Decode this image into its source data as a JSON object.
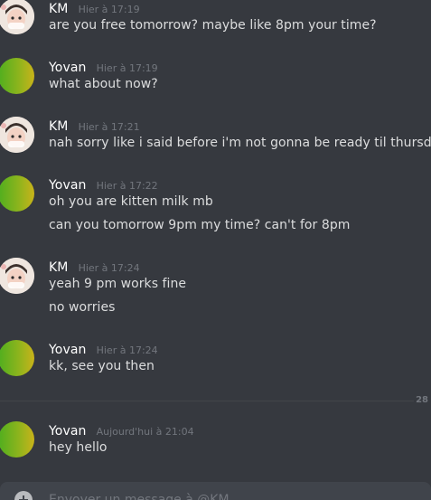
{
  "groups": [
    {
      "author": "KM",
      "time": "Hier à 17:19",
      "avatar": "photo",
      "lines": [
        "are you free tomorrow? maybe like 8pm your time?"
      ]
    },
    {
      "author": "Yovan",
      "time": "Hier à 17:19",
      "avatar": "gradient",
      "lines": [
        "what about now?"
      ]
    },
    {
      "author": "KM",
      "time": "Hier à 17:21",
      "avatar": "photo",
      "lines": [
        "nah sorry like i said before i'm not gonna be ready til thursday"
      ]
    },
    {
      "author": "Yovan",
      "time": "Hier à 17:22",
      "avatar": "gradient",
      "lines": [
        "oh you are kitten milk mb",
        "can you tomorrow 9pm my time? can't for 8pm"
      ]
    },
    {
      "author": "KM",
      "time": "Hier à 17:24",
      "avatar": "photo",
      "lines": [
        "yeah 9 pm works fine",
        "no worries"
      ]
    },
    {
      "author": "Yovan",
      "time": "Hier à 17:24",
      "avatar": "gradient",
      "lines": [
        "kk, see you then"
      ]
    },
    {
      "author": "Yovan",
      "time": "Aujourd'hui à 21:04",
      "avatar": "gradient",
      "lines": [
        "hey hello"
      ]
    }
  ],
  "date_divider": "28",
  "composer": {
    "placeholder": "Envoyer un message à @KM",
    "plus_icon": "plus-circle-icon"
  }
}
